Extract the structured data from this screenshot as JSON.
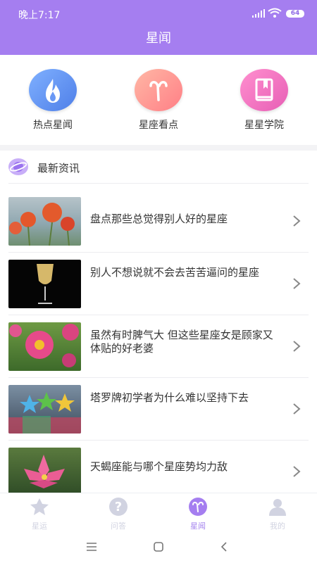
{
  "status_bar": {
    "time": "晚上7:17",
    "battery": "64"
  },
  "header": {
    "title": "星闻"
  },
  "shortcuts": [
    {
      "label": "热点星闻",
      "icon": "flame-icon"
    },
    {
      "label": "星座看点",
      "icon": "aries-icon"
    },
    {
      "label": "星星学院",
      "icon": "book-icon"
    }
  ],
  "news": {
    "title": "最新资讯",
    "items": [
      {
        "title": "盘点那些总觉得别人好的星座",
        "thumb": "red-poppies"
      },
      {
        "title": "别人不想说就不会去苦苦逼问的星座",
        "thumb": "wine-glass"
      },
      {
        "title": "虽然有时脾气大 但这些星座女是顾家又体贴的好老婆",
        "thumb": "pink-daisies"
      },
      {
        "title": "塔罗牌初学者为什么难以坚持下去",
        "thumb": "colorful-stars"
      },
      {
        "title": "天蝎座能与哪个星座势均力敌",
        "thumb": "lotus-flower"
      }
    ]
  },
  "tabbar": {
    "tabs": [
      {
        "label": "星运",
        "icon": "star-icon"
      },
      {
        "label": "问答",
        "icon": "question-icon"
      },
      {
        "label": "星闻",
        "icon": "aries-icon",
        "active": true
      },
      {
        "label": "我的",
        "icon": "user-icon"
      }
    ]
  },
  "colors": {
    "accent": "#a57ef0",
    "tab_inactive": "#d1d3e1"
  }
}
